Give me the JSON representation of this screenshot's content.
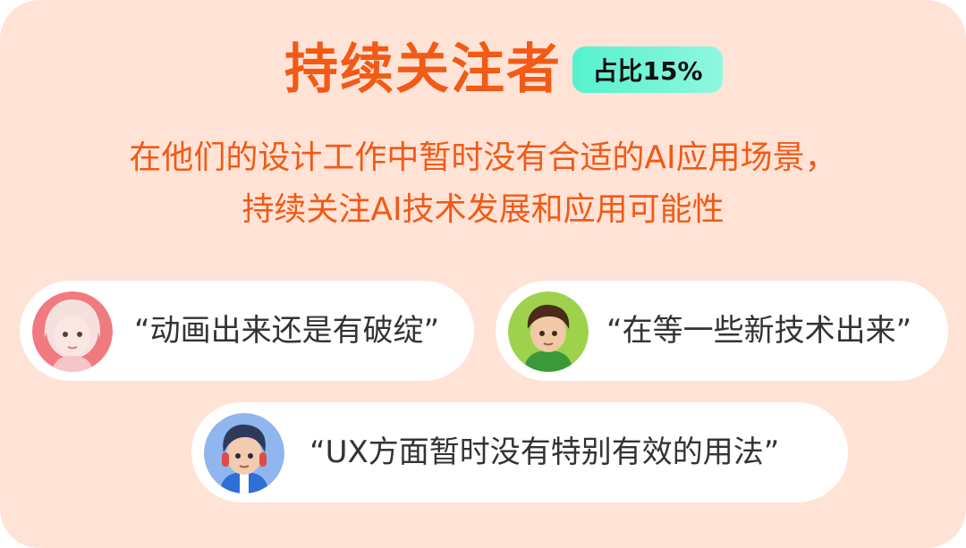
{
  "header": {
    "title": "持续关注者",
    "badge": "占比15%"
  },
  "description": {
    "line1": "在他们的设计工作中暂时没有合适的AI应用场景，",
    "line2": "持续关注AI技术发展和应用可能性"
  },
  "quotes": [
    {
      "text": "“动画出来还是有破绽”",
      "avatar": "girl-avatar"
    },
    {
      "text": "“在等一些新技术出来”",
      "avatar": "boy-green-hoodie-avatar"
    },
    {
      "text": "“UX方面暂时没有特别有效的用法”",
      "avatar": "boy-headphones-avatar"
    }
  ],
  "colors": {
    "background": "#ffe3d6",
    "accent": "#f25a16",
    "badge": "#56f1cf",
    "pill": "#ffffff",
    "quote_text": "#333333"
  }
}
